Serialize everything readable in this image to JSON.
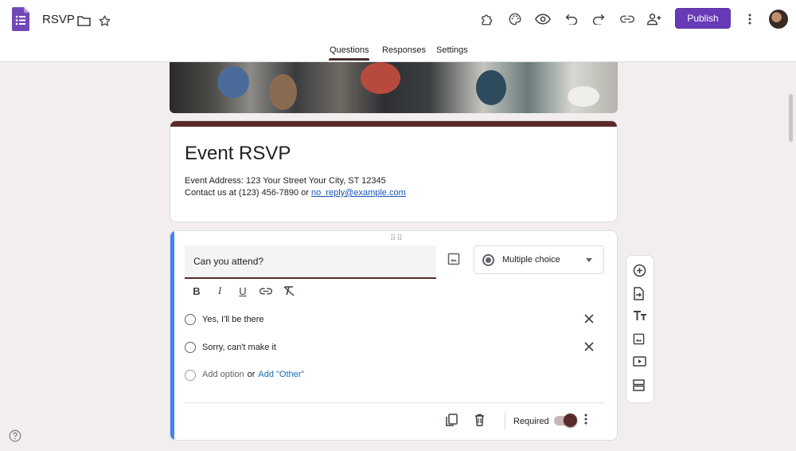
{
  "header": {
    "doc_title": "RSVP",
    "publish_label": "Publish",
    "icons": [
      "forms-logo-icon",
      "folder-icon",
      "star-icon",
      "addons-icon",
      "palette-icon",
      "preview-eye-icon",
      "undo-icon",
      "redo-icon",
      "link-icon",
      "add-collaborator-icon",
      "more-vert-icon"
    ],
    "accent_color": "#673ab7"
  },
  "tabs": [
    {
      "label": "Questions",
      "active": true
    },
    {
      "label": "Responses",
      "active": false
    },
    {
      "label": "Settings",
      "active": false
    }
  ],
  "form": {
    "title": "Event RSVP",
    "address_line": "Event Address: 123 Your Street Your City, ST 12345",
    "contact_prefix": "Contact us at (123) 456-7890 or ",
    "contact_email": "no_reply@example.com",
    "theme_color": "#5a2a2a"
  },
  "question": {
    "text": "Can you attend?",
    "type_label": "Multiple choice",
    "options": [
      "Yes,  I'll be there",
      "Sorry, can't make it"
    ],
    "add_option_label": "Add option",
    "or_label": "or",
    "add_other_label": "Add \"Other\"",
    "required_label": "Required",
    "required": true
  },
  "side_toolbar": {
    "icons": [
      "add-question-icon",
      "import-questions-icon",
      "add-title-icon",
      "add-image-icon",
      "add-video-icon",
      "add-section-icon"
    ]
  }
}
